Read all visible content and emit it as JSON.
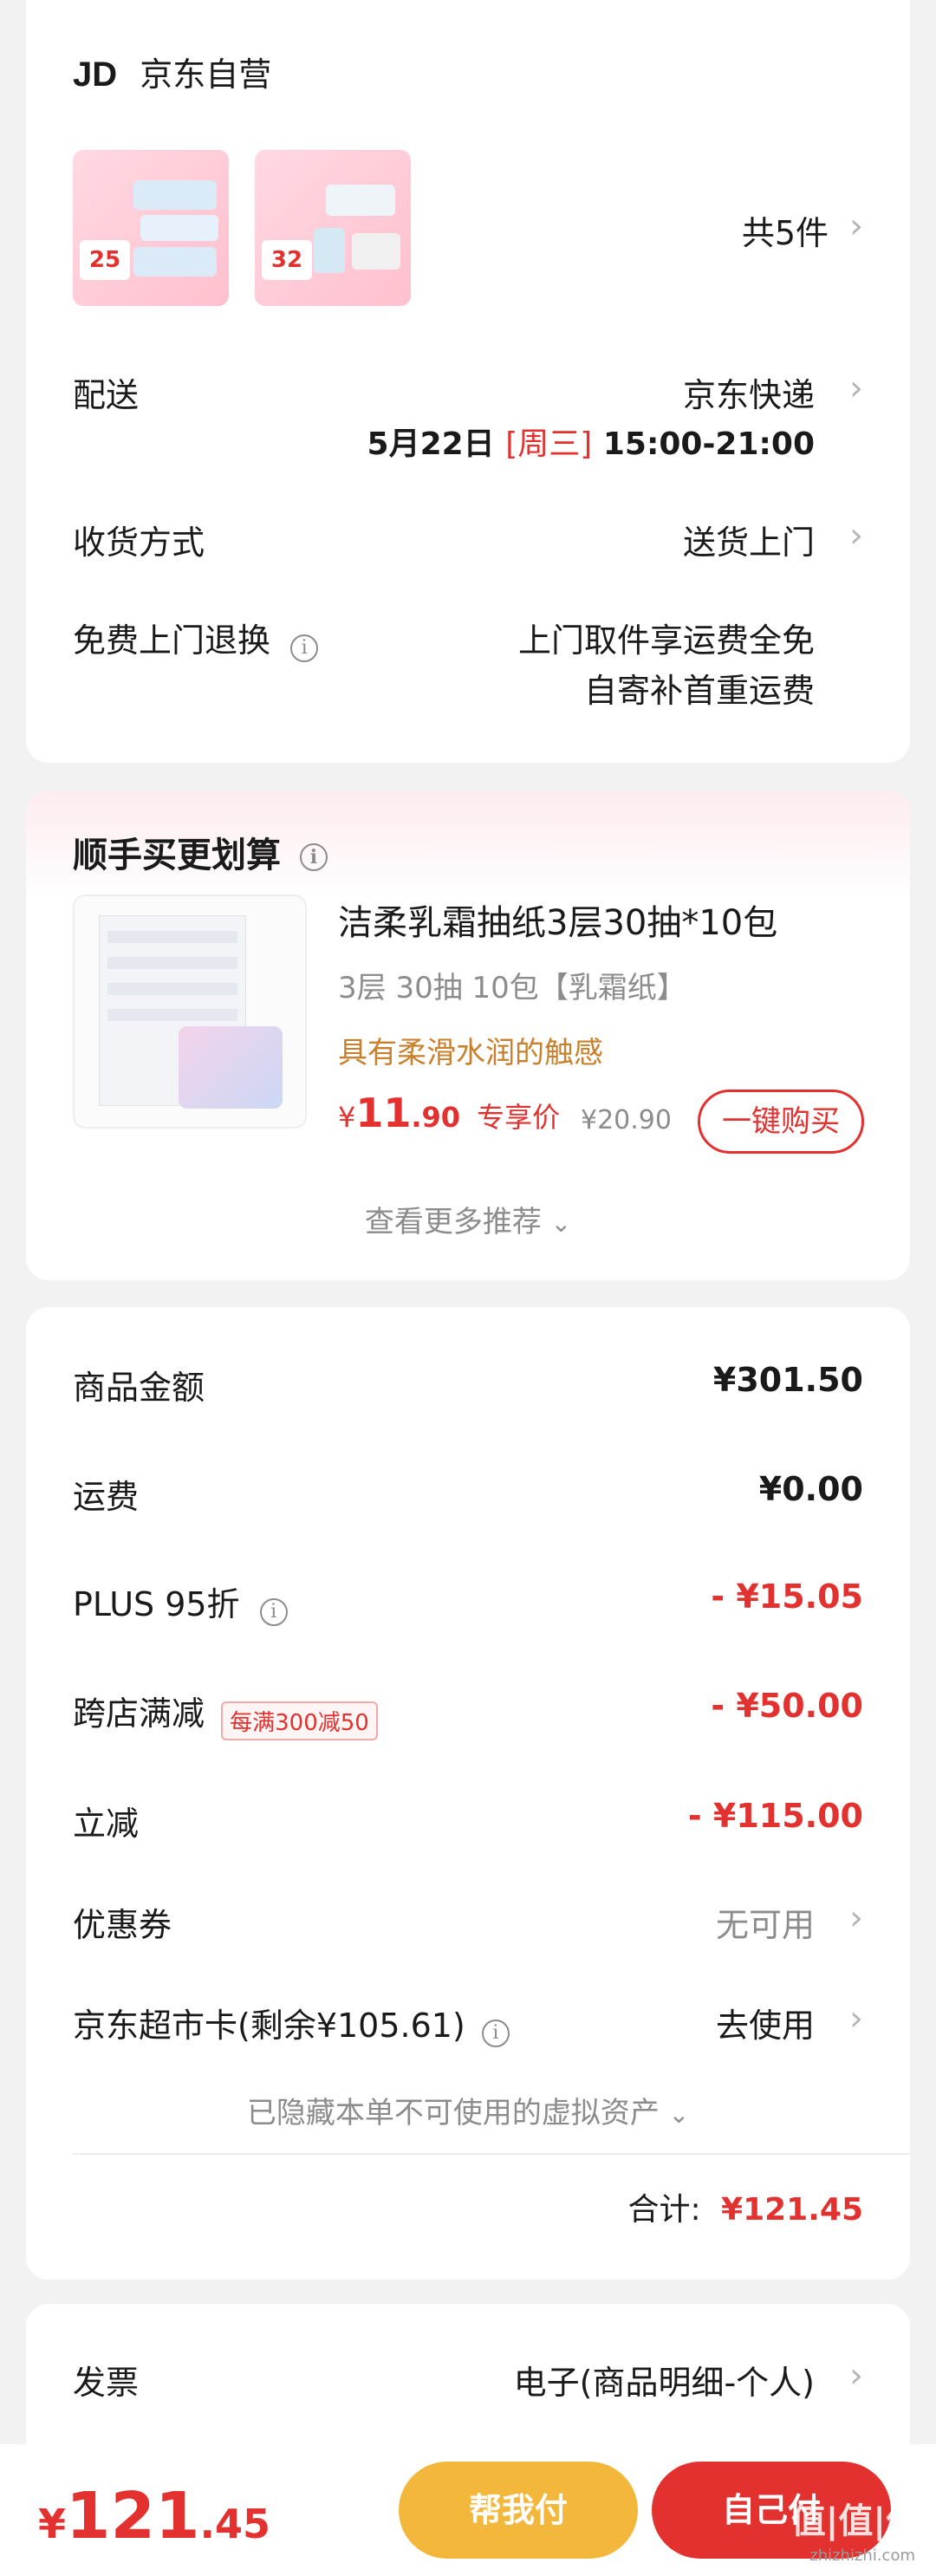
{
  "shop": {
    "logo": "JD",
    "name": "京东自营",
    "count_label": "共5件"
  },
  "delivery": {
    "label": "配送",
    "carrier": "京东快递",
    "date": "5月22日",
    "weekday": "[周三]",
    "time": "15:00-21:00"
  },
  "receive": {
    "label": "收货方式",
    "value": "送货上门"
  },
  "returns": {
    "label": "免费上门退换",
    "line1": "上门取件享运费全免",
    "line2": "自寄补首重运费"
  },
  "addon": {
    "title": "顺手买更划算",
    "product_title": "洁柔乳霜抽纸3层30抽*10包",
    "spec": "3层 30抽 10包【乳霜纸】",
    "tagline": "具有柔滑水润的触感",
    "price_symbol": "¥",
    "price_int": "11",
    "price_dec": ".90",
    "price_tag": "专享价",
    "orig_price": "¥20.90",
    "buy_button": "一键购买",
    "more": "查看更多推荐"
  },
  "summary": {
    "rows": [
      {
        "label": "商品金额",
        "value": "¥301.50"
      },
      {
        "label": "运费",
        "value": "¥0.00"
      },
      {
        "label": "PLUS 95折",
        "value": "- ¥15.05"
      },
      {
        "label": "跨店满减",
        "badge": "每满300减50",
        "value": "- ¥50.00"
      },
      {
        "label": "立减",
        "value": "- ¥115.00"
      },
      {
        "label": "优惠券",
        "value": "无可用"
      },
      {
        "label": "京东超市卡(剩余¥105.61)",
        "value": "去使用"
      }
    ],
    "hidden_note": "已隐藏本单不可使用的虚拟资产",
    "total_label": "合计:",
    "total_value": "¥121.45"
  },
  "invoice": {
    "label": "发票",
    "value": "电子(商品明细-个人)"
  },
  "bottom": {
    "price_symbol": "¥",
    "price_int": "121",
    "price_dec": ".45",
    "help_pay": "帮我付",
    "self_pay": "自己付",
    "watermark": "值|值|值",
    "watermark_url": "zhizhizhi.com"
  },
  "colors": {
    "accent": "#e2312f",
    "help_pay": "#f3b73c",
    "orange_text": "#c9802c"
  }
}
